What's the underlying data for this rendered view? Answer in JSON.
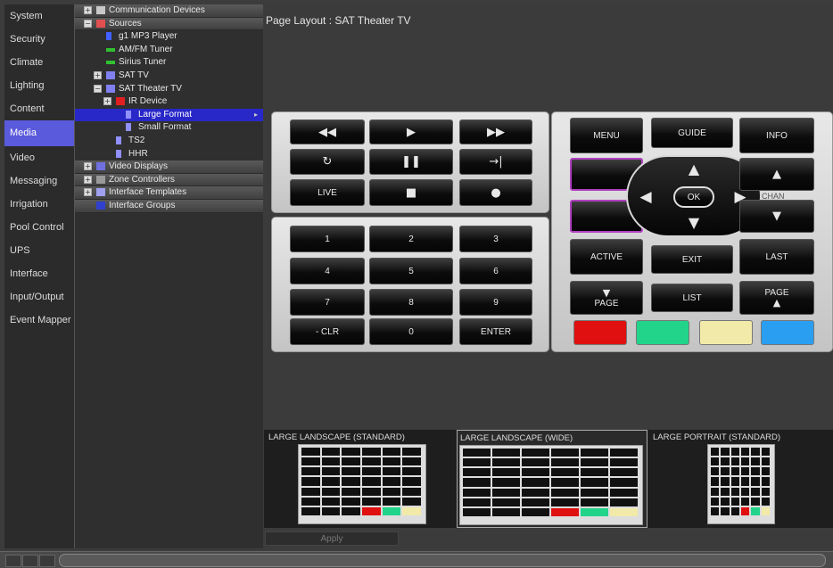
{
  "leftnav": {
    "items": [
      {
        "label": "System"
      },
      {
        "label": "Security"
      },
      {
        "label": "Climate"
      },
      {
        "label": "Lighting"
      },
      {
        "label": "Content"
      },
      {
        "label": "Media",
        "active": true
      },
      {
        "label": "Video"
      },
      {
        "label": "Messaging"
      },
      {
        "label": "Irrigation"
      },
      {
        "label": "Pool Control"
      },
      {
        "label": "UPS"
      },
      {
        "label": "Interface"
      },
      {
        "label": "Input/Output"
      },
      {
        "label": "Event Mapper"
      }
    ]
  },
  "tree": {
    "rows": [
      {
        "label": "Communication Devices",
        "level": 0,
        "header": true,
        "expander": "+",
        "icon": "network-icon"
      },
      {
        "label": "Sources",
        "level": 0,
        "header": true,
        "expander": "−",
        "icon": "sources-icon"
      },
      {
        "label": "g1 MP3 Player",
        "level": 1,
        "icon": "music-note-icon"
      },
      {
        "label": "AM/FM Tuner",
        "level": 1,
        "icon": "tuner-icon"
      },
      {
        "label": "Sirius Tuner",
        "level": 1,
        "icon": "tuner-icon"
      },
      {
        "label": "SAT TV",
        "level": 1,
        "expander": "+",
        "icon": "tv-icon"
      },
      {
        "label": "SAT Theater TV",
        "level": 1,
        "expander": "−",
        "icon": "tv-icon"
      },
      {
        "label": "IR Device",
        "level": 2,
        "expander": "+",
        "icon": "ir-icon"
      },
      {
        "label": "Large Format",
        "level": 3,
        "icon": "page-icon",
        "selected": true
      },
      {
        "label": "Small Format",
        "level": 3,
        "icon": "page-icon"
      },
      {
        "label": "TS2",
        "level": 2,
        "icon": "page-icon"
      },
      {
        "label": "HHR",
        "level": 2,
        "icon": "page-icon"
      },
      {
        "label": "Video Displays",
        "level": 0,
        "header": true,
        "expander": "+",
        "icon": "display-icon"
      },
      {
        "label": "Zone Controllers",
        "level": 0,
        "header": true,
        "expander": "+",
        "icon": "zone-icon"
      },
      {
        "label": "Interface Templates",
        "level": 0,
        "header": true,
        "expander": "+",
        "icon": "template-icon"
      },
      {
        "label": "Interface Groups",
        "level": 0,
        "header": true,
        "icon": "groups-icon"
      }
    ]
  },
  "main": {
    "page_title": "Page Layout : SAT Theater TV",
    "apply_label": "Apply"
  },
  "remote": {
    "transport": {
      "rewind": "◀◀",
      "play": "▶",
      "fast_forward": "▶▶",
      "replay": "↻",
      "pause": "❚❚",
      "skip": "→|",
      "live": "LIVE",
      "stop": "■",
      "record": "●"
    },
    "keypad": [
      "1",
      "2",
      "3",
      "4",
      "5",
      "6",
      "7",
      "8",
      "9",
      "- CLR",
      "0",
      "ENTER"
    ],
    "nav": {
      "menu": "MENU",
      "guide": "GUIDE",
      "info": "INFO",
      "ok": "OK",
      "up": "▲",
      "down": "▼",
      "left": "◀",
      "right": "▶",
      "chan": "CHAN",
      "active": "ACTIVE",
      "exit": "EXIT",
      "last": "LAST",
      "page_down": "PAGE",
      "list": "LIST",
      "page_up": "PAGE"
    },
    "color_buttons": [
      "#e01010",
      "#22d48a",
      "#f2eaa8",
      "#2a9ef0"
    ]
  },
  "thumbnails": [
    {
      "label": "LARGE LANDSCAPE (STANDARD)",
      "selected": false
    },
    {
      "label": "LARGE LANDSCAPE (WIDE)",
      "selected": true
    },
    {
      "label": "LARGE PORTRAIT (STANDARD)",
      "selected": false
    }
  ]
}
